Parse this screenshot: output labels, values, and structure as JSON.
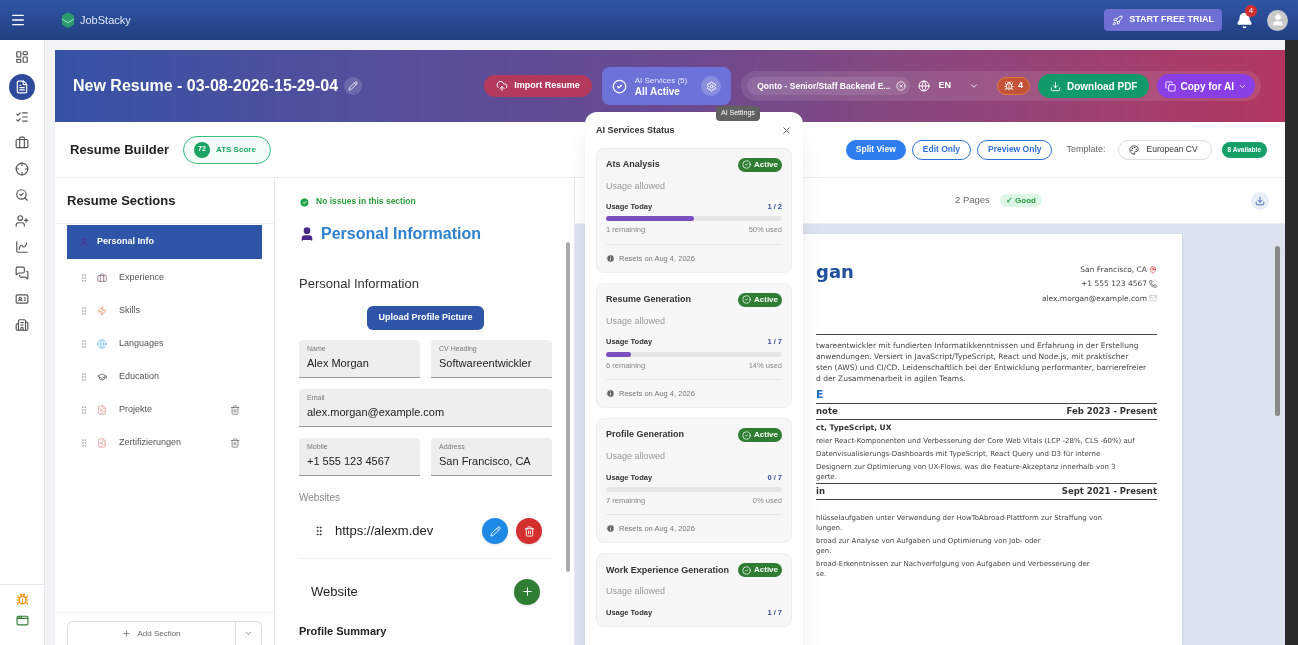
{
  "app": {
    "brand": "JobStacky",
    "trial_button": "START FREE TRIAL",
    "notification_count": "4"
  },
  "rail": [
    {
      "kind": "dashboard",
      "selected": false
    },
    {
      "kind": "resume",
      "selected": true
    },
    {
      "kind": "checklist",
      "selected": false
    },
    {
      "kind": "briefcase",
      "selected": false
    },
    {
      "kind": "target",
      "selected": false
    },
    {
      "kind": "search",
      "selected": false
    },
    {
      "kind": "user-plus",
      "selected": false
    },
    {
      "kind": "chart",
      "selected": false
    },
    {
      "kind": "chat",
      "selected": false
    },
    {
      "kind": "card",
      "selected": false
    },
    {
      "kind": "building",
      "selected": false
    }
  ],
  "banner": {
    "title": "New Resume - 03-08-2026-15-29-04",
    "import_button": "Import Resume",
    "ai_services": {
      "label": "AI Services (5)",
      "status": "All Active"
    },
    "tooltip": "AI Settings",
    "job_chip": "Qonto - Senior/Staff Backend E...",
    "language": "EN",
    "issues_count": "4",
    "download_button": "Download PDF",
    "copy_button": "Copy for AI"
  },
  "toolbar": {
    "title": "Resume Builder",
    "ats_score": "72",
    "ats_label": "ATS Score",
    "views": [
      {
        "label": "Split View",
        "selected": true
      },
      {
        "label": "Edit Only",
        "selected": false
      },
      {
        "label": "Preview Only",
        "selected": false
      }
    ],
    "template_label": "Template:",
    "template": "European CV",
    "available": "8 Available"
  },
  "sections": {
    "title": "Resume Sections",
    "add_button": "Add Section",
    "items": [
      {
        "label": "Personal Info",
        "kind": "person",
        "selected": true,
        "deletable": false
      },
      {
        "label": "Experience",
        "kind": "briefcase",
        "selected": false,
        "deletable": false
      },
      {
        "label": "Skills",
        "kind": "bolt",
        "selected": false,
        "deletable": false
      },
      {
        "label": "Languages",
        "kind": "globe",
        "selected": false,
        "deletable": false
      },
      {
        "label": "Education",
        "kind": "cap",
        "selected": false,
        "deletable": false
      },
      {
        "label": "Projekte",
        "kind": "doc",
        "selected": false,
        "deletable": true
      },
      {
        "label": "Zertifizierungen",
        "kind": "doc",
        "selected": false,
        "deletable": true
      }
    ]
  },
  "form": {
    "status": "No issues in this section",
    "heading": "Personal Information",
    "subheading": "Personal Information",
    "upload_button": "Upload Profile Picture",
    "fields": [
      {
        "label": "Name",
        "value": "Alex Morgan",
        "wide": false
      },
      {
        "label": "CV Heading",
        "value": "Softwareentwickler",
        "wide": false
      },
      {
        "label": "Email",
        "value": "alex.morgan@example.com",
        "wide": true
      },
      {
        "label": "Mobile",
        "value": "+1 555 123 4567",
        "wide": false
      },
      {
        "label": "Address",
        "value": "San Francisco, CA",
        "wide": false
      }
    ],
    "websites_label": "Websites",
    "websites": [
      "https://alexm.dev"
    ],
    "website_title": "Website",
    "next_section": "Profile Summary"
  },
  "ai_status": {
    "title": "AI Services Status",
    "services": [
      {
        "name": "Ats Analysis",
        "status": "Active",
        "note": "Usage allowed",
        "usage_label": "Usage Today",
        "usage": "1 / 2",
        "level": 0.5,
        "remaining": "1 remaining",
        "used": "50% used",
        "resets": "Resets on Aug 4, 2026"
      },
      {
        "name": "Resume Generation",
        "status": "Active",
        "note": "Usage allowed",
        "usage_label": "Usage Today",
        "usage": "1 / 7",
        "level": 0.14,
        "remaining": "6 remaining",
        "used": "14% used",
        "resets": "Resets on Aug 4, 2026"
      },
      {
        "name": "Profile Generation",
        "status": "Active",
        "note": "Usage allowed",
        "usage_label": "Usage Today",
        "usage": "0 / 7",
        "level": 0,
        "remaining": "7 remaining",
        "used": "0% used",
        "resets": "Resets on Aug 4, 2026"
      },
      {
        "name": "Work Experience Generation",
        "status": "Active",
        "note": "Usage allowed",
        "usage_label": "Usage Today",
        "usage": "1 / 7"
      }
    ]
  },
  "preview": {
    "pages": "2 Pages",
    "quality": "✓ Good",
    "name": "gan",
    "contacts": [
      {
        "kind": "location",
        "text": "San Francisco, CA"
      },
      {
        "kind": "phone",
        "text": "+1 555 123 4567"
      },
      {
        "kind": "email",
        "text": "alex.morgan@example.com"
      }
    ],
    "summary": [
      "twareentwickler mit fundierten Informatikkenntnissen und Erfahrung in der Erstellung",
      "anwendungen. Versiert in JavaScript/TypeScript, React und Node.js, mit praktischer",
      "sten (AWS) und CI/CD. Leidenschaftlich bei der Entwicklung performanter, barrierefreier",
      "d der Zusammenarbeit in agilen Teams."
    ],
    "section_heading": "E",
    "jobs": [
      {
        "title": "note",
        "dates": "Feb 2023 - Present",
        "tags": "ct, TypeScript, UX",
        "lines": [
          [
            "reier React-Komponenten und Verbesserung der Core Web Vitals (LCP -28%, CLS -60%) auf"
          ],
          [
            "Datenvisualisierungs-Dashboards mit TypeScript, React Query und D3 für interne"
          ],
          [
            "Designern zur Optimierung von UX-Flows, was die Feature-Akzeptanz innerhalb von 3",
            "gerte."
          ]
        ]
      },
      {
        "title": "in",
        "dates": "Sept 2021 - Present",
        "lines": [
          [
            "hlüsselaufgaben unter Verwendung der HowToAbroad-Plattform zur Straffung von",
            "lungen."
          ],
          [
            "broad zur Analyse von Aufgaben und Optimierung von Job- oder",
            "gen."
          ],
          [
            "broad-Erkenntnissen zur Nachverfolgung von Aufgaben und Verbesserung der",
            "se."
          ]
        ]
      }
    ]
  }
}
